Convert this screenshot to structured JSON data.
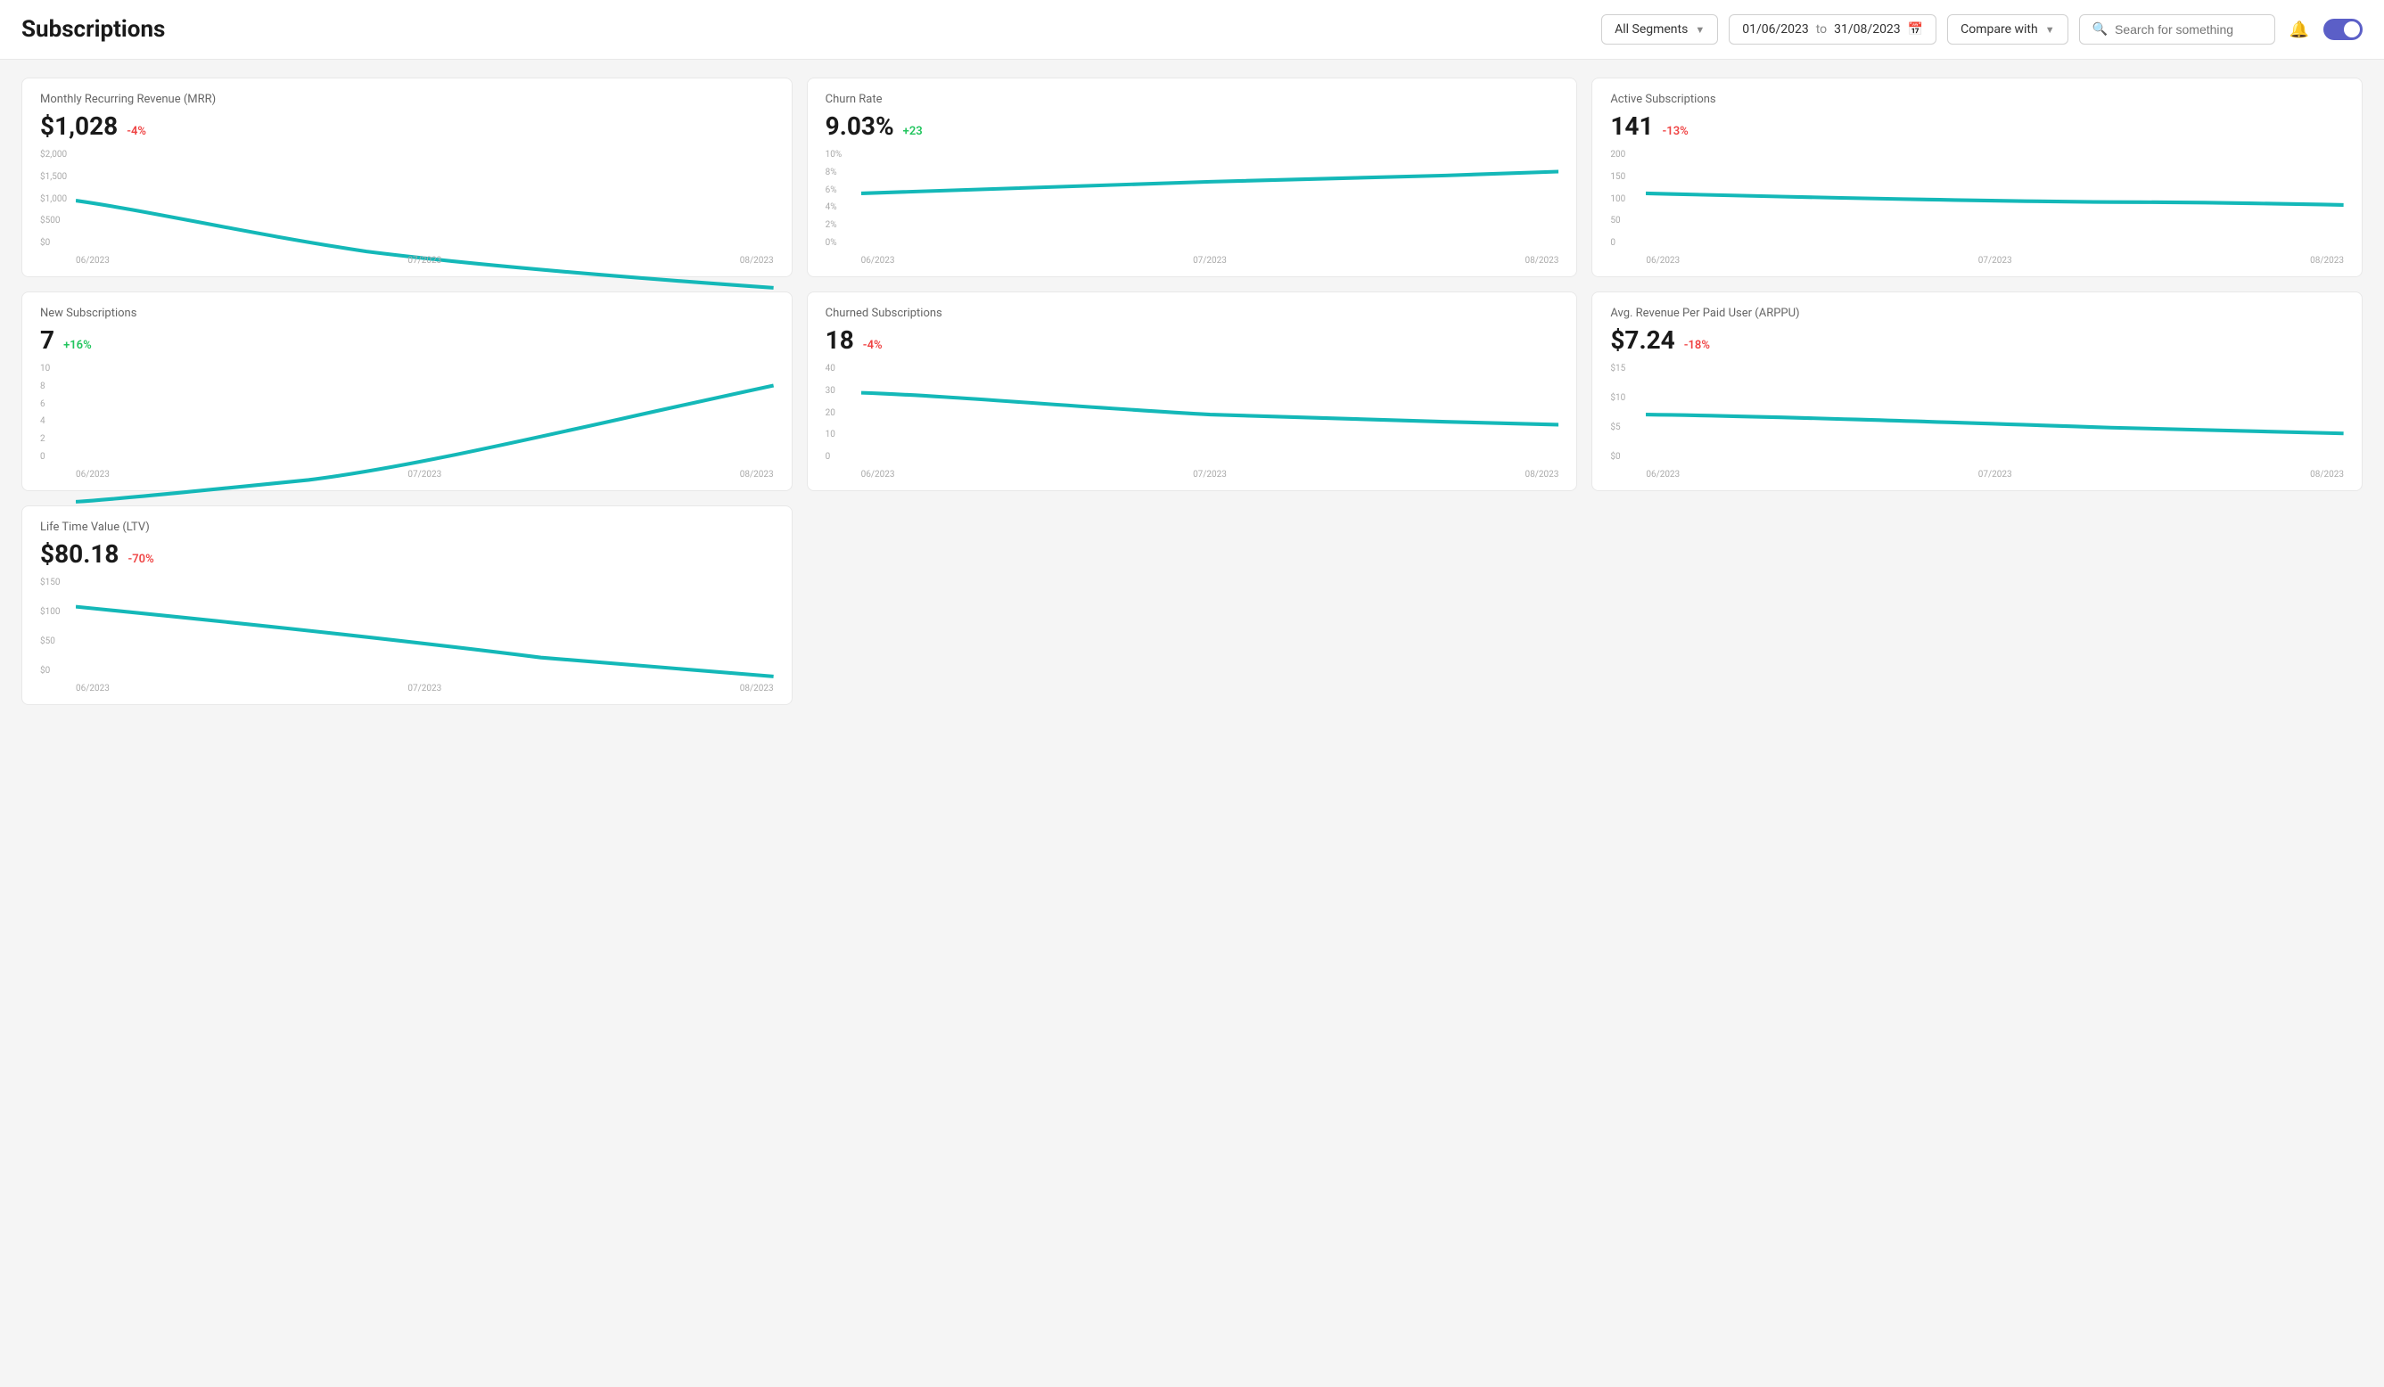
{
  "header": {
    "title": "Subscriptions",
    "segments_label": "All Segments",
    "date_from": "01/06/2023",
    "date_to": "31/08/2023",
    "compare_label": "Compare with",
    "search_placeholder": "Search for something"
  },
  "cards": [
    {
      "id": "mrr",
      "title": "Monthly Recurring Revenue (MRR)",
      "value": "$1,028",
      "badge": "-4%",
      "badge_type": "negative",
      "y_labels": [
        "$2,000",
        "$1,500",
        "$1,000",
        "$500",
        "$0"
      ],
      "x_labels": [
        "06/2023",
        "07/2023",
        "08/2023"
      ],
      "line_points": "0,40 100,65 200,80 300,90 400,95 480,100",
      "line_path": "M0,35 C50,42 120,58 200,70 C280,80 380,88 480,95"
    },
    {
      "id": "churn",
      "title": "Churn Rate",
      "value": "9.03%",
      "badge": "+23",
      "badge_type": "positive",
      "y_labels": [
        "10%",
        "8%",
        "6%",
        "4%",
        "2%",
        "0%"
      ],
      "x_labels": [
        "06/2023",
        "07/2023",
        "08/2023"
      ],
      "line_path": "M0,30 C60,28 150,25 240,22 C330,20 400,18 480,15"
    },
    {
      "id": "active",
      "title": "Active Subscriptions",
      "value": "141",
      "badge": "-13%",
      "badge_type": "negative",
      "y_labels": [
        "200",
        "150",
        "100",
        "50",
        "0"
      ],
      "x_labels": [
        "06/2023",
        "07/2023",
        "08/2023"
      ],
      "line_path": "M0,30 C80,32 200,35 320,36 C380,36 430,37 480,38"
    },
    {
      "id": "new-subs",
      "title": "New Subscriptions",
      "value": "7",
      "badge": "+16%",
      "badge_type": "positive",
      "y_labels": [
        "10",
        "8",
        "6",
        "4",
        "2",
        "0"
      ],
      "x_labels": [
        "06/2023",
        "07/2023",
        "08/2023"
      ],
      "line_path": "M0,95 C30,93 80,88 160,80 C240,70 340,45 480,15"
    },
    {
      "id": "churned",
      "title": "Churned Subscriptions",
      "value": "18",
      "badge": "-4%",
      "badge_type": "negative",
      "y_labels": [
        "40",
        "30",
        "20",
        "10",
        "0"
      ],
      "x_labels": [
        "06/2023",
        "07/2023",
        "08/2023"
      ],
      "line_path": "M0,20 C60,22 150,30 240,35 C330,38 400,40 480,42"
    },
    {
      "id": "arppu",
      "title": "Avg. Revenue Per Paid User (ARPPU)",
      "value": "$7.24",
      "badge": "-18%",
      "badge_type": "negative",
      "y_labels": [
        "$15",
        "$10",
        "$5",
        "$0"
      ],
      "x_labels": [
        "06/2023",
        "07/2023",
        "08/2023"
      ],
      "line_path": "M0,35 C80,36 200,40 320,44 C380,46 430,47 480,48"
    }
  ],
  "bottom_cards": [
    {
      "id": "ltv",
      "title": "Life Time Value (LTV)",
      "value": "$80.18",
      "badge": "-70%",
      "badge_type": "negative",
      "y_labels": [
        "$150",
        "$100",
        "$50",
        "$0"
      ],
      "x_labels": [
        "06/2023",
        "07/2023",
        "08/2023"
      ],
      "line_path": "M0,20 C80,28 200,40 320,55 C380,60 430,64 480,68"
    }
  ]
}
